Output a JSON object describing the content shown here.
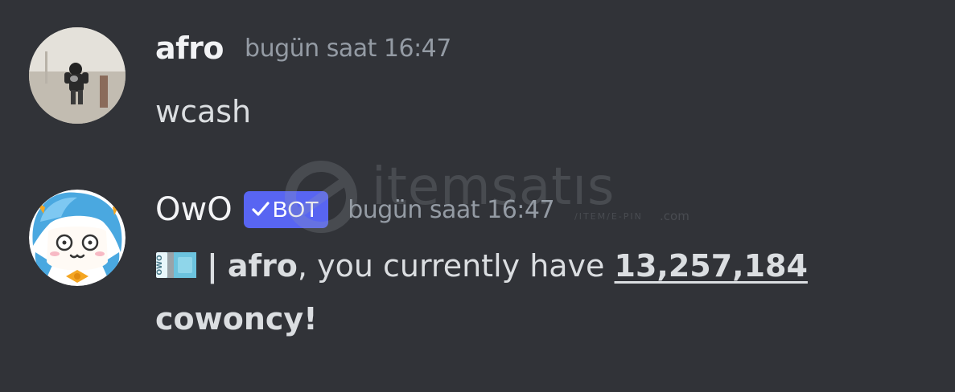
{
  "messages": [
    {
      "username": "afro",
      "timestamp": "bugün saat 16:47",
      "text": "wcash"
    },
    {
      "username": "OwO",
      "bot_tag": "BOT",
      "timestamp": "bugün saat 16:47",
      "separator": "|",
      "mention": "afro",
      "text_middle": ", you currently have ",
      "amount": "13,257,184",
      "currency": "cowoncy!"
    }
  ],
  "icons": {
    "cash": "cowoncy-cash-icon",
    "bot_check": "checkmark-icon"
  },
  "watermark": {
    "brand": "itemsatıs",
    "sub": "/ITEM/E-PIN",
    "domain": ".com"
  },
  "colors": {
    "background": "#313338",
    "bot_tag": "#5865f2",
    "timestamp": "#949ba4",
    "text": "#dbdee1"
  }
}
